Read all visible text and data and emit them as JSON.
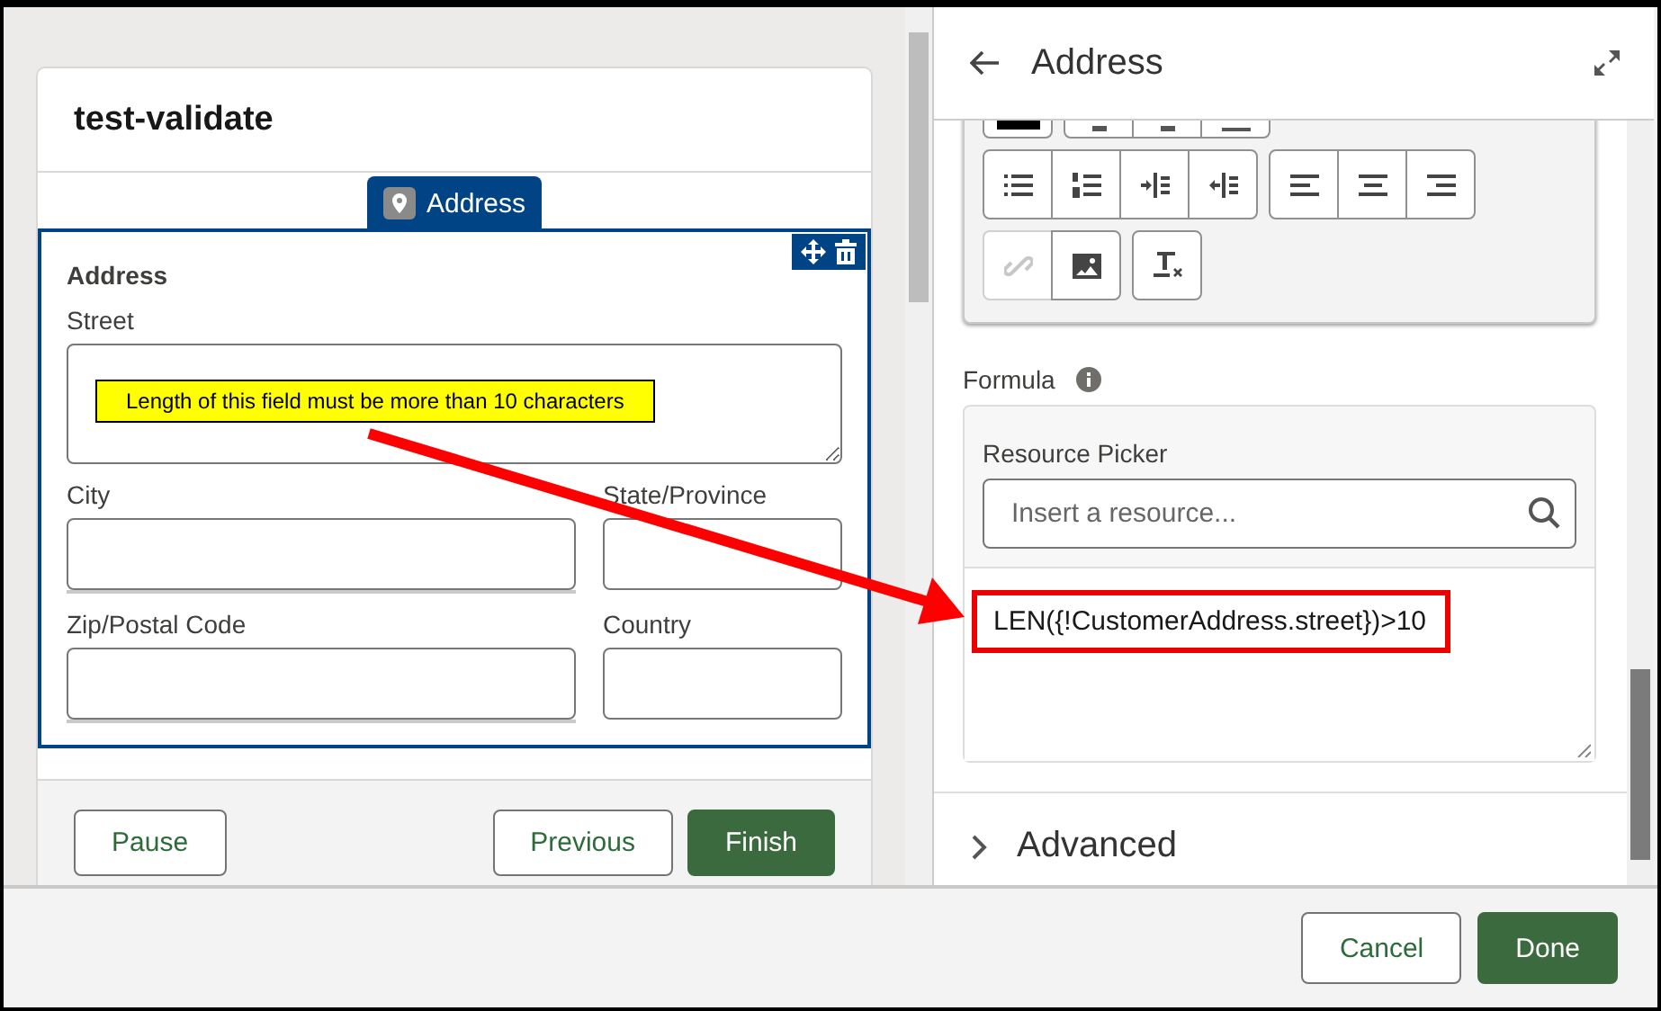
{
  "canvas": {
    "screen_title": "test-validate",
    "component_tab": "Address",
    "component": {
      "title": "Address",
      "fields": [
        {
          "label": "Street",
          "kind": "textarea"
        },
        {
          "label": "City",
          "kind": "input"
        },
        {
          "label": "State/Province",
          "kind": "input"
        },
        {
          "label": "Zip/Postal Code",
          "kind": "input"
        },
        {
          "label": "Country",
          "kind": "input"
        }
      ]
    },
    "footer_buttons": [
      {
        "label": "Pause",
        "kind": "secondary"
      },
      {
        "label": "Previous",
        "kind": "secondary"
      },
      {
        "label": "Finish",
        "kind": "primary"
      }
    ]
  },
  "annotation": {
    "callout": "Length of this field must be more than 10 characters"
  },
  "panel": {
    "title": "Address",
    "toolbar_rows": [
      {
        "groups": [
          {
            "buttons": [
              {
                "kind": "swatch",
                "disabled": false
              }
            ]
          },
          {
            "buttons": [
              {
                "kind": "mark",
                "disabled": false
              },
              {
                "kind": "mark",
                "disabled": false
              },
              {
                "kind": "rule",
                "disabled": false
              }
            ]
          }
        ]
      },
      {
        "groups": [
          {
            "buttons": [
              {
                "kind": "bullets",
                "disabled": false
              },
              {
                "kind": "numbers",
                "disabled": false
              },
              {
                "kind": "indent",
                "disabled": false
              },
              {
                "kind": "outdent",
                "disabled": false
              }
            ]
          },
          {
            "buttons": [
              {
                "kind": "left",
                "disabled": false
              },
              {
                "kind": "center",
                "disabled": false
              },
              {
                "kind": "right",
                "disabled": false
              }
            ]
          }
        ]
      },
      {
        "groups": [
          {
            "buttons": [
              {
                "kind": "link",
                "disabled": true
              },
              {
                "kind": "image",
                "disabled": false
              }
            ]
          },
          {
            "buttons": [
              {
                "kind": "clear",
                "disabled": false
              }
            ]
          }
        ]
      }
    ],
    "formula": {
      "label": "Formula",
      "resource_picker": {
        "label": "Resource Picker",
        "placeholder": "Insert a resource..."
      },
      "value": "LEN({!CustomerAddress.street})>10"
    },
    "sections": [
      {
        "label": "Advanced",
        "expanded": false
      }
    ]
  },
  "footer_buttons": [
    {
      "label": "Cancel",
      "kind": "secondary"
    },
    {
      "label": "Done",
      "kind": "primary"
    }
  ]
}
